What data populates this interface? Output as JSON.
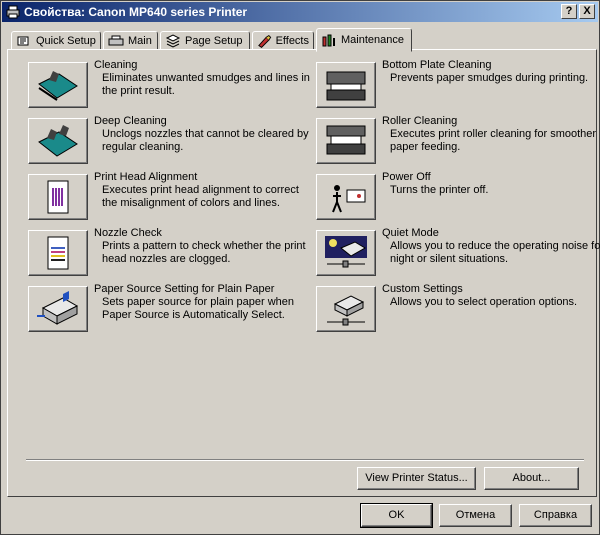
{
  "window": {
    "title": "Свойства: Canon MP640 series Printer"
  },
  "titlebar_buttons": {
    "help": "?",
    "close": "X"
  },
  "tabs": [
    {
      "label": "Quick Setup",
      "icon": "quick-setup-icon"
    },
    {
      "label": "Main",
      "icon": "main-icon"
    },
    {
      "label": "Page Setup",
      "icon": "page-setup-icon"
    },
    {
      "label": "Effects",
      "icon": "effects-icon"
    },
    {
      "label": "Maintenance",
      "icon": "maintenance-icon",
      "active": true
    }
  ],
  "left_items": [
    {
      "title": "Cleaning",
      "desc": "Eliminates unwanted smudges and lines in the print result.",
      "icon": "cleaning-icon"
    },
    {
      "title": "Deep Cleaning",
      "desc": "Unclogs nozzles that cannot be cleared by regular cleaning.",
      "icon": "deep-cleaning-icon"
    },
    {
      "title": "Print Head Alignment",
      "desc": "Executes print head alignment to correct the misalignment of colors and lines.",
      "icon": "print-head-alignment-icon"
    },
    {
      "title": "Nozzle Check",
      "desc": "Prints a pattern to check whether the print head nozzles are clogged.",
      "icon": "nozzle-check-icon"
    },
    {
      "title": "Paper Source Setting for Plain Paper",
      "desc": "Sets paper source for plain paper when Paper Source is Automatically Select.",
      "icon": "paper-source-icon"
    }
  ],
  "right_items": [
    {
      "title": "Bottom Plate Cleaning",
      "desc": "Prevents paper smudges during printing.",
      "icon": "bottom-plate-cleaning-icon"
    },
    {
      "title": "Roller Cleaning",
      "desc": "Executes print roller cleaning for smoother paper feeding.",
      "icon": "roller-cleaning-icon"
    },
    {
      "title": "Power Off",
      "desc": "Turns the printer off.",
      "icon": "power-off-icon"
    },
    {
      "title": "Quiet Mode",
      "desc": "Allows you to reduce the operating noise for night or silent situations.",
      "icon": "quiet-mode-icon"
    },
    {
      "title": "Custom Settings",
      "desc": "Allows you to select operation options.",
      "icon": "custom-settings-icon"
    }
  ],
  "panel_buttons": {
    "view_status": "View Printer Status...",
    "about": "About..."
  },
  "dialog_buttons": {
    "ok": "OK",
    "cancel": "Отмена",
    "help": "Справка"
  },
  "colors": {
    "titlebar_start": "#0a246a",
    "titlebar_end": "#a6caf0",
    "face": "#d4d0c8"
  }
}
